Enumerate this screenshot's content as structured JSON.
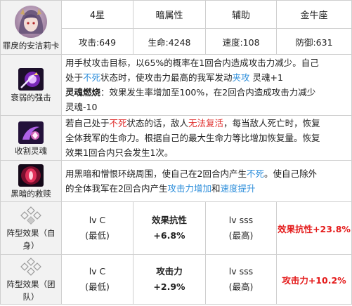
{
  "hero": {
    "name": "罪戾的安洁莉卡",
    "stars": "4星",
    "attribute": "暗属性",
    "role": "辅助",
    "zodiac": "金牛座",
    "attack": "攻击:649",
    "hp": "生命:4248",
    "speed": "速度:108",
    "defense": "防御:631"
  },
  "skills": [
    {
      "name": "衰弱的强击",
      "icon": "weakening-strike-icon",
      "lines": [
        [
          {
            "t": "用手杖攻击目标，以65%的概率在1回合内造成攻击力减少。自己"
          }
        ],
        [
          {
            "t": "处于"
          },
          {
            "t": "不死",
            "c": "kw"
          },
          {
            "t": "状态时，使攻击力最高的我军发动"
          },
          {
            "t": "夹攻",
            "c": "kw"
          },
          {
            "t": " 灵魂+1"
          }
        ],
        [
          {
            "t": "灵魂燃烧",
            "c": "bold"
          },
          {
            "t": "：效果发生率增加至100%，在2回合内造成攻击力减少"
          }
        ],
        [
          {
            "t": "灵魂-10"
          }
        ]
      ]
    },
    {
      "name": "收割灵魂",
      "icon": "reap-soul-icon",
      "lines": [
        [
          {
            "t": "若自己处于"
          },
          {
            "t": "不死",
            "c": "kw-red"
          },
          {
            "t": "状态的话，敌人"
          },
          {
            "t": "无法复活",
            "c": "kw-red"
          },
          {
            "t": "，每当敌人死亡时，恢复"
          }
        ],
        [
          {
            "t": "全体我军的生命力。根据自己的最大生命力等比增加恢复量。恢复"
          }
        ],
        [
          {
            "t": "效果1回合内只会发生1次。"
          }
        ]
      ]
    },
    {
      "name": "黑暗的救赎",
      "icon": "dark-redemption-icon",
      "lines": [
        [
          {
            "t": "用黑暗和憎恨环绕周围，使自己在2回合内产生"
          },
          {
            "t": "不死",
            "c": "kw"
          },
          {
            "t": "。使自己除外"
          }
        ],
        [
          {
            "t": "的全体我军在2回合内产生"
          },
          {
            "t": "攻击力增加",
            "c": "kw"
          },
          {
            "t": "和"
          },
          {
            "t": "速度提升",
            "c": "kw"
          }
        ]
      ]
    }
  ],
  "formations": [
    {
      "name_line1": "阵型效果（自",
      "name_line2": "身）",
      "low_level": "lv C",
      "low_label": "(最低)",
      "stat_name": "效果抗性",
      "stat_low": "+6.8%",
      "high_level": "lv sss",
      "high_label": "(最高)",
      "result": "效果抗性+23.8%"
    },
    {
      "name_line1": "阵型效果（团",
      "name_line2": "队）",
      "low_level": "lv C",
      "low_label": "(最低)",
      "stat_name": "攻击力",
      "stat_low": "+2.9%",
      "high_level": "lv sss",
      "high_label": "(最高)",
      "result": "攻击力+10.2%"
    }
  ],
  "colors": {
    "keyword_blue": "#2f8fdb",
    "keyword_red": "#e0302e",
    "result_red": "#e41b1b",
    "left_bg": "#f2f2f2",
    "border": "#cfcfcf"
  },
  "icons": [
    "hero-avatar-icon",
    "weakening-strike-icon",
    "reap-soul-icon",
    "dark-redemption-icon",
    "formation-diamond-icon"
  ]
}
